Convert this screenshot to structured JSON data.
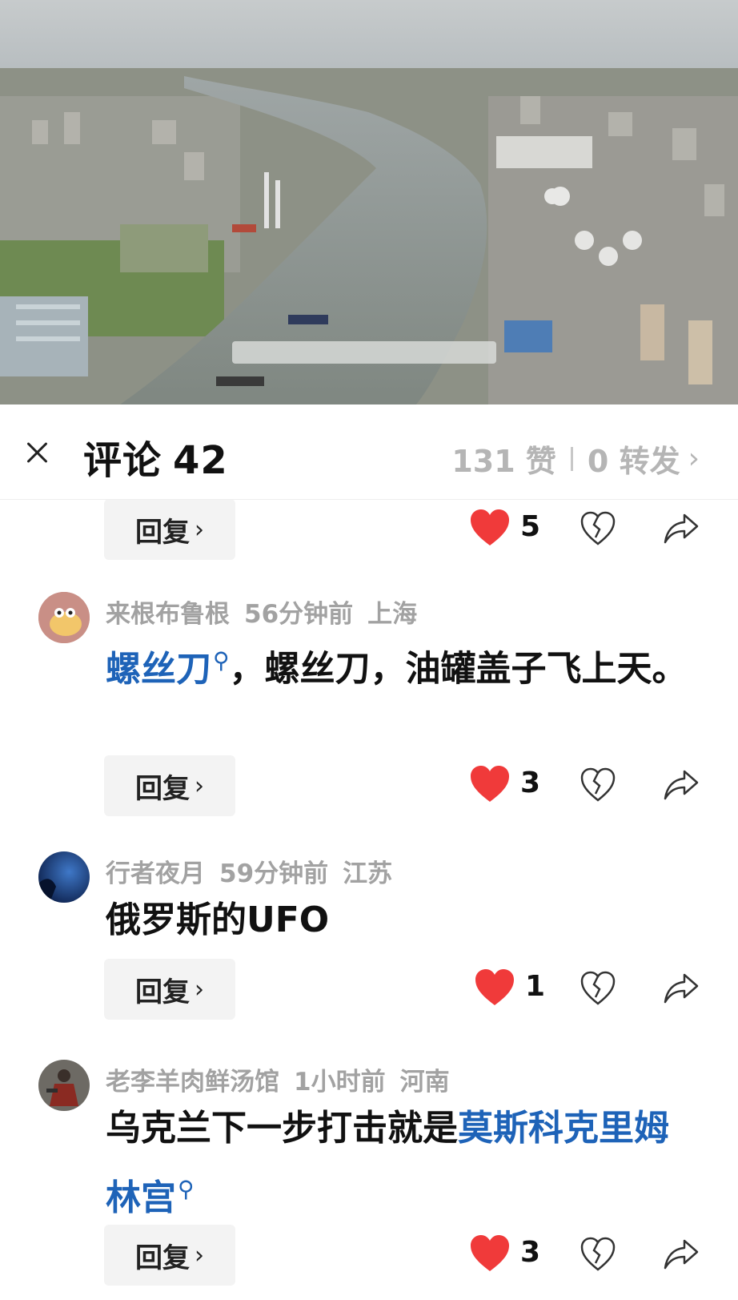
{
  "header": {
    "title": "评论",
    "comment_count": "42",
    "likes": "131 赞",
    "reposts": "0 转发",
    "chevron": "›"
  },
  "reply_label": "回复",
  "reply_arrow": "›",
  "first_row": {
    "likes": "5"
  },
  "comments": [
    {
      "user": "来根布鲁根",
      "time": "56分钟前",
      "location": "上海",
      "link": "螺丝刀",
      "text": "，螺丝刀，油罐盖子飞上天。",
      "likes": "3"
    },
    {
      "user": "行者夜月",
      "time": "59分钟前",
      "location": "江苏",
      "text": "俄罗斯的UFO",
      "likes": "1"
    },
    {
      "user": "老李羊肉鲜汤馆",
      "time": "1小时前",
      "location": "河南",
      "text": "乌克兰下一步打击就是",
      "link": "莫斯科克里姆林宫",
      "likes": "3"
    }
  ],
  "colors": {
    "link": "#1e63b8",
    "like": "#f03a3a",
    "meta": "#a2a2a2"
  },
  "icons": [
    "close-icon",
    "heart-icon",
    "broken-heart-icon",
    "share-icon",
    "search-icon"
  ]
}
